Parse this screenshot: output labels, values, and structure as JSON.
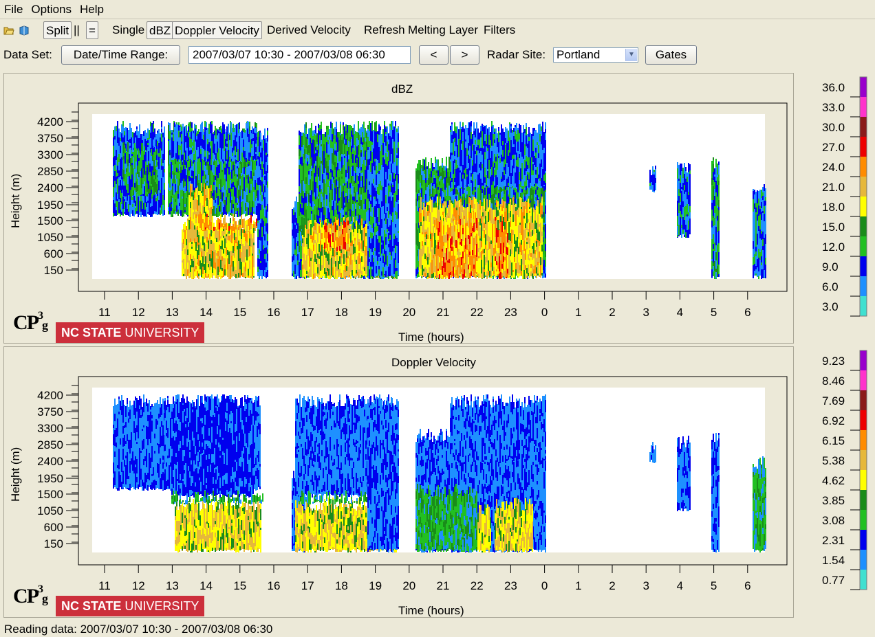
{
  "menu": [
    "File",
    "Options",
    "Help"
  ],
  "toolbar": {
    "open_icon": "open-folder-icon",
    "book_icon": "book-icon",
    "split": "Split",
    "parallel": "||",
    "equal": "=",
    "single": "Single",
    "dbz": "dBZ",
    "doppler_velocity": "Doppler Velocity",
    "derived_velocity": "Derived Velocity",
    "refresh": "Refresh",
    "melting_layer": "Melting Layer",
    "filters": "Filters"
  },
  "dataset": {
    "label": "Data Set:",
    "range_button": "Date/Time Range:",
    "range_value": "2007/03/07 10:30 - 2007/03/08 06:30",
    "prev": "<",
    "next": ">",
    "radar_site_label": "Radar Site:",
    "radar_site": "Portland",
    "gates": "Gates"
  },
  "x_ticks": [
    "11",
    "12",
    "13",
    "14",
    "15",
    "16",
    "17",
    "18",
    "19",
    "20",
    "21",
    "22",
    "23",
    "0",
    "1",
    "2",
    "3",
    "4",
    "5",
    "6"
  ],
  "y_ticks": [
    "4200",
    "3750",
    "3300",
    "2850",
    "2400",
    "1950",
    "1500",
    "1050",
    "600",
    "150"
  ],
  "logo": {
    "cp": "CP",
    "sup": "3",
    "sub": "g",
    "nc": "NC STATE",
    "univ": " UNIVERSITY"
  },
  "colors": [
    "#40e0d0",
    "#1e90ff",
    "#0000ee",
    "#22c022",
    "#1a8c1a",
    "#ffff00",
    "#e6b83a",
    "#ff8c00",
    "#ee0000",
    "#8b1a1a",
    "#ff33cc",
    "#9900cc"
  ],
  "charts": [
    {
      "title": "dBZ",
      "xlabel": "Time (hours)",
      "ylabel": "Height (m)",
      "legend": [
        "36.0",
        "33.0",
        "30.0",
        "27.0",
        "24.0",
        "21.0",
        "18.0",
        "15.0",
        "12.0",
        "9.0",
        "6.0",
        "3.0"
      ]
    },
    {
      "title": "Doppler Velocity",
      "xlabel": "Time (hours)",
      "ylabel": "Height (m)",
      "legend": [
        "9.23",
        "8.46",
        "7.69",
        "6.92",
        "6.15",
        "5.38",
        "4.62",
        "3.85",
        "3.08",
        "2.31",
        "1.54",
        "0.77"
      ]
    }
  ],
  "status": "Reading data: 2007/03/07 10:30 - 2007/03/08 06:30"
}
